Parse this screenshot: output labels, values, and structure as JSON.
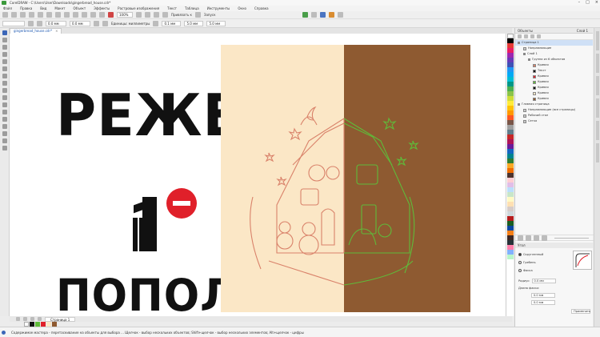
{
  "window": {
    "title": "CorelDRAW - C:\\Users\\User\\Downloads\\gingerbread_house.cdr*",
    "controls": [
      "–",
      "□",
      "×"
    ]
  },
  "menu": [
    "Файл",
    "Правка",
    "Вид",
    "Макет",
    "Объект",
    "Эффекты",
    "Растровые изображения",
    "Текст",
    "Таблица",
    "Инструменты",
    "Окно",
    "Справка"
  ],
  "toolbar": {
    "zoom": "100%",
    "snap_label": "Привязать к",
    "launch_label": "Запуск",
    "size_w": "0.0 мм",
    "size_h": "0.0 мм",
    "units_label": "Единицы: миллиметры",
    "nudge": "0.1 мм",
    "dup_x": "5.0 мм",
    "dup_y": "5.0 мм"
  },
  "document_tab": "gingerbread_house.cdr*",
  "canvas": {
    "headline_top": "РЕЖЕМ",
    "headline_bottom": "ПОПОЛАМ"
  },
  "pagebar": {
    "page_label": "Страница 1"
  },
  "statusbar": {
    "text": "Содержимое мастера - перетаскивание на объекты для выбора ... Щелчок - выбор нескольких объектов; Shift+щелчок - выбор нескольких элементов; Alt+щелчок - цифры"
  },
  "objects_docker": {
    "title": "Объекты",
    "header_right": "Слой 1",
    "layers": [
      {
        "label": "Страница 1",
        "selected": true
      },
      {
        "label": "Направляющие"
      },
      {
        "label": "Слой 1"
      },
      {
        "label": "Группа из 6 объектов"
      },
      {
        "label": "Кривая"
      },
      {
        "label": "Текст"
      },
      {
        "label": "Кривая"
      },
      {
        "label": "Кривая"
      },
      {
        "label": "Кривая"
      },
      {
        "label": "Кривая"
      },
      {
        "label": "Кривая"
      },
      {
        "label": "Главная страница"
      },
      {
        "label": "Направляющие (все страницы)"
      },
      {
        "label": "Рабочий стол"
      },
      {
        "label": "Сетка"
      }
    ]
  },
  "effects_docker": {
    "title": "Угол",
    "options": [
      "Скругленный",
      "Гребень",
      "Фаска"
    ],
    "radius_label": "Радиус:",
    "radius_value": "0.0 мм",
    "edge_label": "Длина фаски:",
    "edge_values": [
      "0.0 мм",
      "0.0 мм"
    ],
    "apply_label": "Применить"
  },
  "colors": {
    "accent": "#3b66b8",
    "left_half": "#fbe7c6",
    "right_half": "#8e5a31",
    "stop_red": "#e0202a",
    "outline_red": "#d9826a",
    "outline_green": "#5fbb3a"
  }
}
